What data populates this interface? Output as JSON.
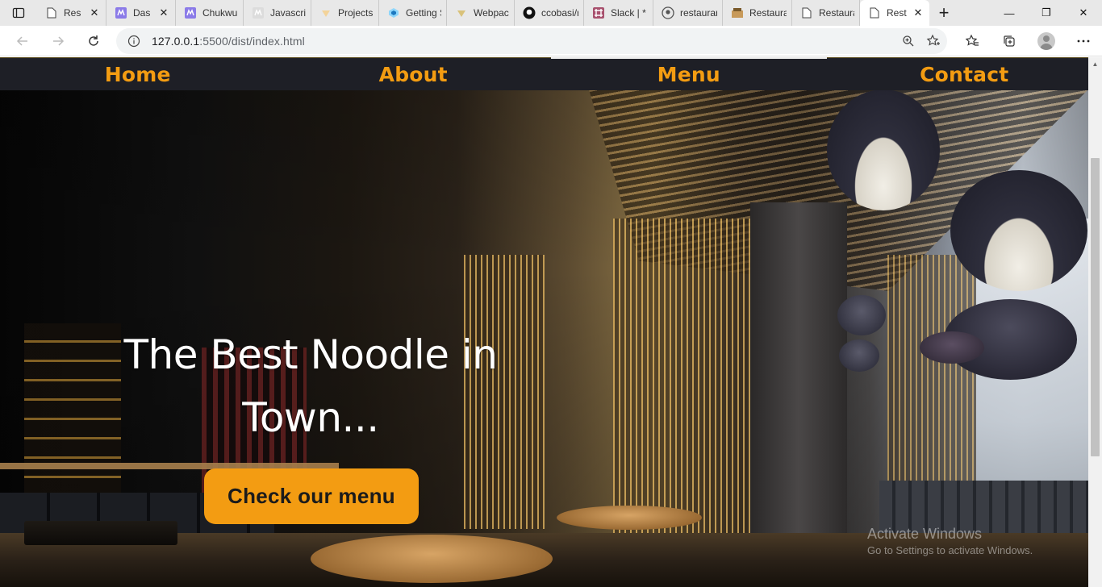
{
  "browser": {
    "tabs": [
      {
        "label": "Res",
        "icon": "page-icon",
        "close": "✕",
        "active": false
      },
      {
        "label": "Das",
        "icon": "netlify-icon",
        "close": "✕",
        "active": false
      },
      {
        "label": "Chukwur",
        "icon": "netlify-icon",
        "close": "",
        "active": false
      },
      {
        "label": "Javascrip",
        "icon": "netlify-icon",
        "close": "",
        "active": false
      },
      {
        "label": "Projects",
        "icon": "project-icon",
        "close": "",
        "active": false
      },
      {
        "label": "Getting S",
        "icon": "webpack-icon",
        "close": "",
        "active": false
      },
      {
        "label": "Webpack",
        "icon": "webpack-icon",
        "close": "",
        "active": false
      },
      {
        "label": "ccobasi/r",
        "icon": "github-icon",
        "close": "",
        "active": false
      },
      {
        "label": "Slack | * I",
        "icon": "slack-icon",
        "close": "",
        "active": false
      },
      {
        "label": "restaurar",
        "icon": "github-icon",
        "close": "",
        "active": false
      },
      {
        "label": "Restaura",
        "icon": "restaurant-icon",
        "close": "",
        "active": false
      },
      {
        "label": "Restaura",
        "icon": "page-icon",
        "close": "",
        "active": false
      },
      {
        "label": "Rest",
        "icon": "page-icon",
        "close": "✕",
        "active": true
      }
    ],
    "new_tab": "+",
    "window": {
      "minimize": "—",
      "maximize": "❐",
      "close": "✕"
    },
    "address": {
      "host": "127.0.0.1",
      "path": ":5500/dist/index.html"
    }
  },
  "site": {
    "nav": [
      {
        "label": "Home",
        "active": false
      },
      {
        "label": "About",
        "active": false
      },
      {
        "label": "Menu",
        "active": true
      },
      {
        "label": "Contact",
        "active": false
      }
    ],
    "hero": {
      "title_line1": "The Best Noodle in",
      "title_line2": "Town...",
      "cta": "Check our menu"
    }
  },
  "watermark": {
    "title": "Activate Windows",
    "subtitle": "Go to Settings to activate Windows."
  },
  "colors": {
    "accent": "#f39c12",
    "nav_bg": "#1e1f26",
    "text_light": "#ffffff"
  }
}
